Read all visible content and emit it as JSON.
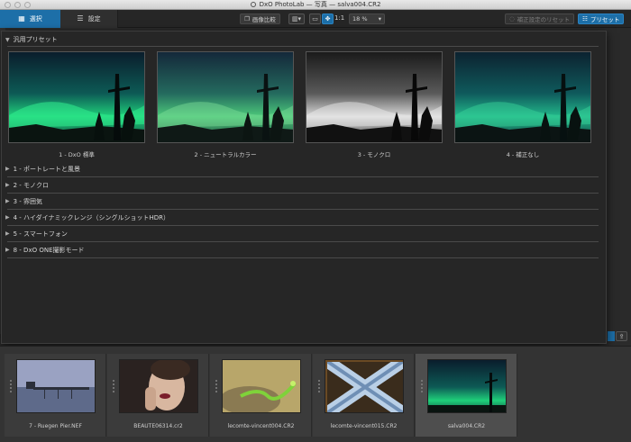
{
  "window": {
    "title": "DxO PhotoLab — 写真 — salva004.CR2"
  },
  "toolbar": {
    "tab_select": "選択",
    "tab_settings": "設定",
    "compare_label": "画像比較",
    "one_to_one": "1:1",
    "zoom_value": "18 %",
    "reset_label": "補正設定のリセット",
    "presets_label": "プリセット"
  },
  "presets_panel": {
    "section_title": "汎用プリセット",
    "presets": [
      {
        "label": "1 - DxO 標準"
      },
      {
        "label": "2 - ニュートラルカラー"
      },
      {
        "label": "3 - モノクロ"
      },
      {
        "label": "4 - 補正なし"
      }
    ],
    "categories": [
      {
        "label": "1 - ポートレートと風景"
      },
      {
        "label": "2 - モノクロ"
      },
      {
        "label": "3 - 雰囲気"
      },
      {
        "label": "4 - ハイダイナミックレンジ（シングルショットHDR）"
      },
      {
        "label": "5 - スマートフォン"
      },
      {
        "label": "8 - DxO ONE撮影モード"
      }
    ]
  },
  "filmstrip": {
    "items": [
      {
        "name": "7 - Ruegen Pier.NEF"
      },
      {
        "name": "BEAUTE06314.cr2"
      },
      {
        "name": "lecomte-vincent004.CR2"
      },
      {
        "name": "lecomte-vincent015.CR2"
      },
      {
        "name": "salva004.CR2"
      }
    ]
  },
  "icons": {
    "grid": "grid-icon",
    "sliders": "sliders-icon",
    "share": "share-icon"
  },
  "colors": {
    "accent": "#1d6fa8",
    "panel_bg": "#262626"
  }
}
